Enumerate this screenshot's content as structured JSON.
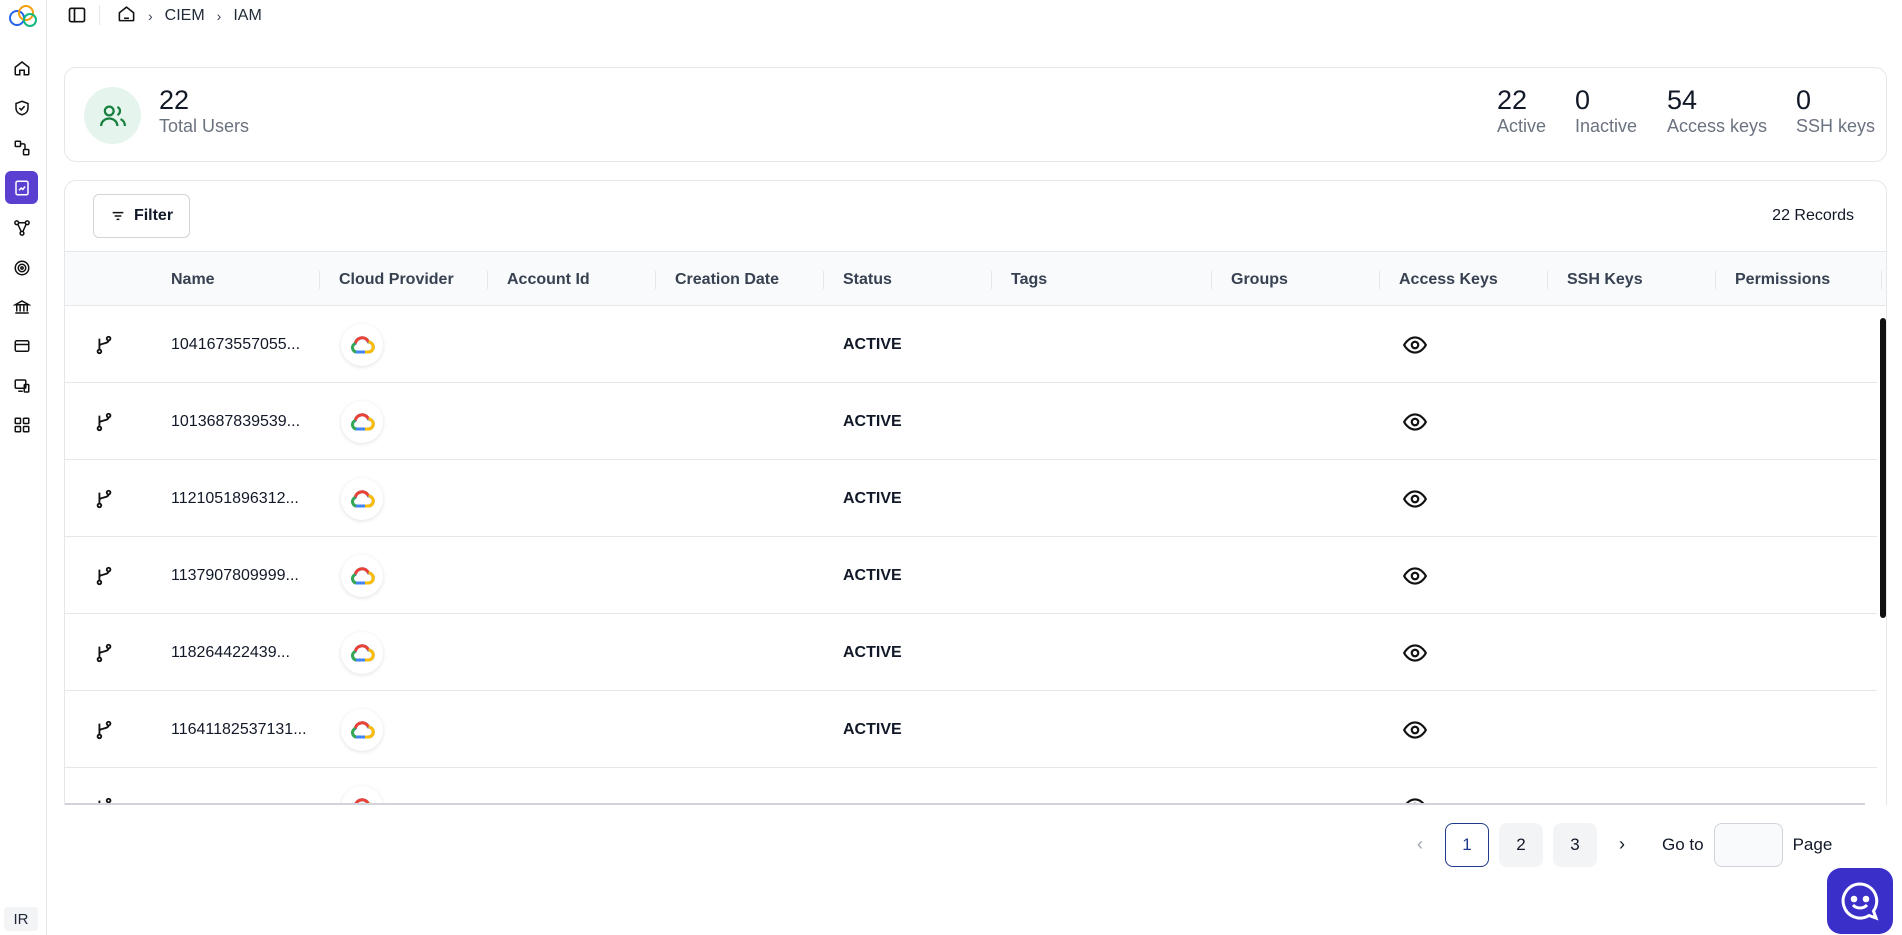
{
  "sidebar": {
    "items": [
      {
        "name": "home-icon",
        "active": false
      },
      {
        "name": "shield-check-icon",
        "active": false
      },
      {
        "name": "workflow-icon",
        "active": false
      },
      {
        "name": "report-icon",
        "active": true
      },
      {
        "name": "graph-icon",
        "active": false
      },
      {
        "name": "target-icon",
        "active": false
      },
      {
        "name": "bank-icon",
        "active": false
      },
      {
        "name": "card-icon",
        "active": false
      },
      {
        "name": "devices-icon",
        "active": false
      },
      {
        "name": "apps-grid-icon",
        "active": false
      }
    ],
    "user_initials": "IR",
    "accent": "#5b3fd0"
  },
  "breadcrumb": {
    "items": [
      "CIEM",
      "IAM"
    ]
  },
  "summary": {
    "total": {
      "value": "22",
      "label": "Total Users"
    },
    "stats": [
      {
        "value": "22",
        "label": "Active"
      },
      {
        "value": "0",
        "label": "Inactive"
      },
      {
        "value": "54",
        "label": "Access keys"
      },
      {
        "value": "0",
        "label": "SSH keys"
      }
    ]
  },
  "toolbar": {
    "filter_label": "Filter",
    "records_label": "22 Records"
  },
  "table": {
    "columns": [
      "Name",
      "Cloud Provider",
      "Account Id",
      "Creation Date",
      "Status",
      "Tags",
      "Groups",
      "Access Keys",
      "SSH Keys",
      "Permissions"
    ],
    "rows": [
      {
        "name": "1041673557055...",
        "status": "ACTIVE"
      },
      {
        "name": "1013687839539...",
        "status": "ACTIVE"
      },
      {
        "name": "1121051896312...",
        "status": "ACTIVE"
      },
      {
        "name": "1137907809999...",
        "status": "ACTIVE"
      },
      {
        "name": "118264422439...",
        "status": "ACTIVE"
      },
      {
        "name": "11641182537131...",
        "status": "ACTIVE"
      }
    ]
  },
  "pagination": {
    "pages": [
      "1",
      "2",
      "3"
    ],
    "current": "1",
    "goto_label": "Go to",
    "page_label": "Page",
    "goto_value": ""
  },
  "colors": {
    "status_accent": "#1e3a8a",
    "chat_button": "#3b2fc9"
  }
}
